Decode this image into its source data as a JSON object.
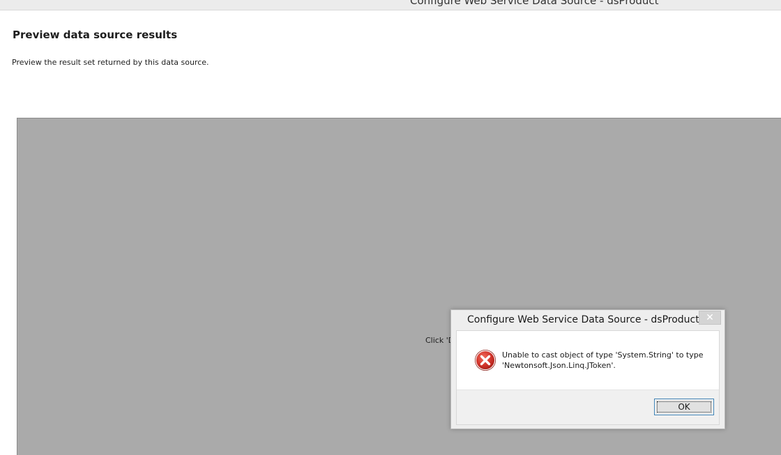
{
  "window": {
    "title": "Configure Web Service Data Source - dsProduct"
  },
  "page": {
    "title": "Preview data source results",
    "description": "Preview the result set returned by this data source."
  },
  "preview": {
    "hint_text": "Click 'D"
  },
  "dialog": {
    "title": "Configure Web Service Data Source - dsProduct",
    "close_glyph": "✕",
    "icon": "error-icon",
    "message_line1": "Unable to cast object of type 'System.String' to type",
    "message_line2": "'Newtonsoft.Json.Linq.JToken'.",
    "ok_label": "OK"
  },
  "colors": {
    "preview_background": "#aaaaaa",
    "error_red": "#c42b1c",
    "button_border_focus": "#3c7fb1"
  }
}
